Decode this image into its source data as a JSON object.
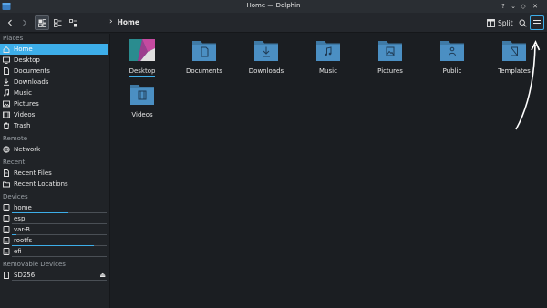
{
  "window": {
    "title": "Home — Dolphin",
    "icon": "dolphin-icon",
    "controls": [
      "help-icon",
      "minimize-icon",
      "restore-icon",
      "close-icon"
    ]
  },
  "toolbar": {
    "breadcrumb": {
      "separator": "›",
      "current": "Home"
    },
    "split_label": "Split",
    "buttons": [
      "back-icon",
      "forward-icon",
      "icons-view-icon",
      "compact-view-icon",
      "details-view-icon",
      "split-icon",
      "search-icon",
      "hamburger-menu-icon"
    ]
  },
  "sidebar": {
    "places_header": "Places",
    "places": [
      {
        "label": "Home",
        "icon": "home-icon",
        "selected": true
      },
      {
        "label": "Desktop",
        "icon": "desktop-icon"
      },
      {
        "label": "Documents",
        "icon": "documents-icon"
      },
      {
        "label": "Downloads",
        "icon": "downloads-icon"
      },
      {
        "label": "Music",
        "icon": "music-icon"
      },
      {
        "label": "Pictures",
        "icon": "pictures-icon"
      },
      {
        "label": "Videos",
        "icon": "videos-icon"
      },
      {
        "label": "Trash",
        "icon": "trash-icon"
      }
    ],
    "remote_header": "Remote",
    "remote": [
      {
        "label": "Network",
        "icon": "network-icon"
      }
    ],
    "recent_header": "Recent",
    "recent": [
      {
        "label": "Recent Files",
        "icon": "recent-files-icon"
      },
      {
        "label": "Recent Locations",
        "icon": "recent-locations-icon"
      }
    ],
    "devices_header": "Devices",
    "devices": [
      {
        "label": "home",
        "icon": "drive-icon",
        "usage": 0.6
      },
      {
        "label": "esp",
        "icon": "drive-icon",
        "usage": 0.0
      },
      {
        "label": "var-B",
        "icon": "drive-icon",
        "usage": 0.05
      },
      {
        "label": "rootfs",
        "icon": "drive-icon",
        "usage": 0.87
      },
      {
        "label": "efi",
        "icon": "drive-icon",
        "usage": 0.0
      }
    ],
    "removable_header": "Removable Devices",
    "removable": [
      {
        "label": "SD256",
        "icon": "sd-card-icon",
        "usage": 0.0,
        "eject": "eject-icon"
      }
    ]
  },
  "main": {
    "items": [
      {
        "label": "Desktop",
        "icon": "desktop-folder-icon",
        "current": true
      },
      {
        "label": "Documents",
        "icon": "documents-folder-icon"
      },
      {
        "label": "Downloads",
        "icon": "downloads-folder-icon"
      },
      {
        "label": "Music",
        "icon": "music-folder-icon"
      },
      {
        "label": "Pictures",
        "icon": "pictures-folder-icon"
      },
      {
        "label": "Public",
        "icon": "public-folder-icon"
      },
      {
        "label": "Templates",
        "icon": "templates-folder-icon"
      },
      {
        "label": "Videos",
        "icon": "videos-folder-icon"
      }
    ]
  },
  "colors": {
    "accent": "#3daee9",
    "folder": "#4b8fc3",
    "folder_tab": "#3f7aa6",
    "background": "#1b1e22"
  }
}
